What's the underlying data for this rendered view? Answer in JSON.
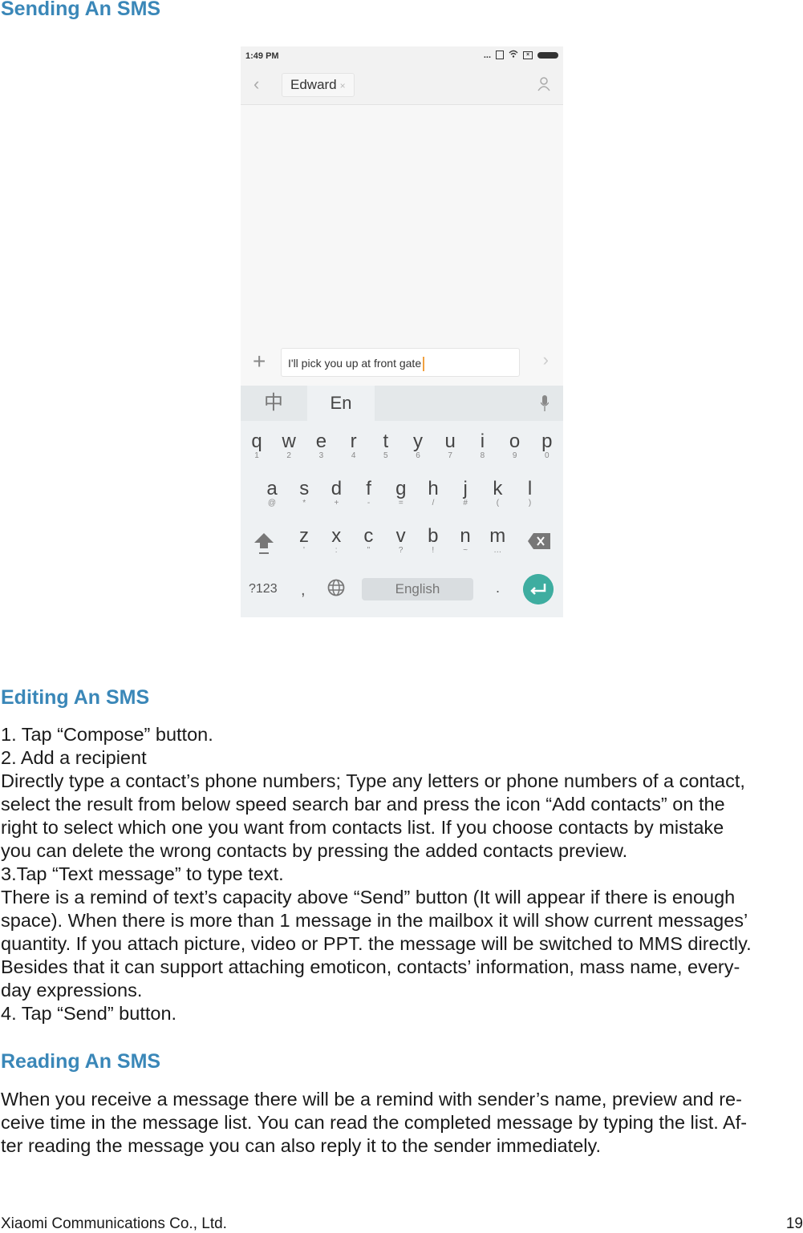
{
  "sections": {
    "sending_title": "Sending An SMS",
    "editing_title": "Editing An SMS",
    "reading_title": "Reading An SMS"
  },
  "phone": {
    "status_time": "1:49 PM",
    "status_dots": "...",
    "recipient": "Edward",
    "recipient_remove": "×",
    "message_text": "I'll pick you up at  front gate",
    "kb_chinese": "中",
    "kb_english": "En",
    "space_label": "English",
    "symbols_label": "?123",
    "comma": ",",
    "period": ".",
    "accent_color": "#3eada0",
    "keys_row1": [
      [
        "q",
        "1"
      ],
      [
        "w",
        "2"
      ],
      [
        "e",
        "3"
      ],
      [
        "r",
        "4"
      ],
      [
        "t",
        "5"
      ],
      [
        "y",
        "6"
      ],
      [
        "u",
        "7"
      ],
      [
        "i",
        "8"
      ],
      [
        "o",
        "9"
      ],
      [
        "p",
        "0"
      ]
    ],
    "keys_row2": [
      [
        "a",
        "@"
      ],
      [
        "s",
        "*"
      ],
      [
        "d",
        "+"
      ],
      [
        "f",
        "-"
      ],
      [
        "g",
        "="
      ],
      [
        "h",
        "/"
      ],
      [
        "j",
        "#"
      ],
      [
        "k",
        "("
      ],
      [
        "l",
        ")"
      ]
    ],
    "keys_row3": [
      [
        "z",
        "'"
      ],
      [
        "x",
        ":"
      ],
      [
        "c",
        "\""
      ],
      [
        "v",
        "?"
      ],
      [
        "b",
        "!"
      ],
      [
        "n",
        "~"
      ],
      [
        "m",
        "…"
      ]
    ]
  },
  "editing": {
    "lines": [
      "1. Tap “Compose” button.",
      "2. Add a recipient",
      "Directly type a contact’s phone numbers; Type any letters or phone numbers of a contact,",
      "select the result from below speed search bar and press the icon “Add contacts” on the",
      "right to select which one you want from contacts list. If you choose contacts by mistake",
      "you can delete the wrong contacts by pressing the added contacts preview.",
      "3.Tap “Text message” to type text.",
      "There is a remind of text’s capacity above “Send” button (It will appear if there is enough",
      "space). When there is more than 1 message in the mailbox it will show current messages’",
      "quantity. If you attach picture, video or PPT. the message will be switched to MMS directly.",
      "Besides that it can support attaching emoticon, contacts’ information, mass name, every-",
      "day expressions.",
      "4. Tap “Send” button."
    ]
  },
  "reading": {
    "lines": [
      "When you receive a message there will be a remind with sender’s name, preview and re-",
      "ceive time in the message list. You can read the completed message by typing the list. Af-",
      "ter reading the message you can also reply it to the sender immediately."
    ]
  },
  "footer": {
    "company": "Xiaomi Communications Co., Ltd.",
    "page_number": "19"
  }
}
